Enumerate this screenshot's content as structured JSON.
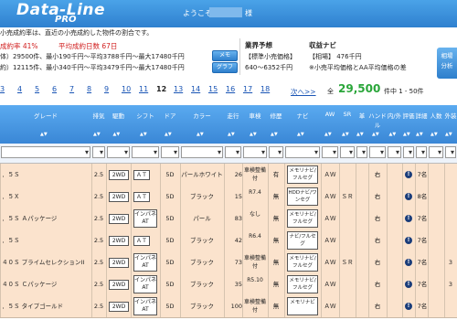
{
  "header": {
    "logo_main": "Data-Line",
    "logo_sub": "PRO",
    "welcome": "ようこそ",
    "honorific": "様"
  },
  "summary": {
    "note": "小売成約率は、直近の小売成約した物件の割合です。",
    "rate_label": "成約率 41%",
    "days_label": "平均成約日数 67日",
    "line1": "体）29500件、最小190千円〜平均3788千円〜最大17480千円",
    "line2": "約）12115件、最小340千円〜平均3479千円〜最大17480千円",
    "memo_button": "メモ",
    "graph_button": "グラフ"
  },
  "forecast": {
    "title": "業界予想",
    "standard_price": "【標準小売価格】",
    "range": "640〜6352千円"
  },
  "navi": {
    "title": "収益ナビ",
    "aa_label": "【相場】 476千円",
    "note": "※小売平均価格とAA平均価格の差"
  },
  "side_button": [
    "相場",
    "分析"
  ],
  "pager": {
    "pages": [
      "3",
      "4",
      "5",
      "6",
      "7",
      "8",
      "9",
      "10",
      "11",
      "12",
      "13",
      "14",
      "15",
      "16",
      "17",
      "18",
      "19",
      "20"
    ],
    "current": "12",
    "next_label": "次へ>>",
    "total_label": "全",
    "total_count": "29,500",
    "range_text": "件中 1 - 50件"
  },
  "table": {
    "headers": [
      "グレード",
      "排気",
      "駆動",
      "シフト",
      "ドア",
      "カラー",
      "走行",
      "車検",
      "修歴",
      "ナビ",
      "AW",
      "SR",
      "革",
      "ハンドル",
      "内/外",
      "評価",
      "詳細",
      "人数",
      "外装"
    ],
    "sort_glyph": "▲▼",
    "rows": [
      {
        "grade": "．５Ｓ",
        "displacement": "2.5",
        "drive": "2WD",
        "shift": "ＡＴ",
        "door": "5D",
        "color": "パールホワイト",
        "mileage": "26",
        "inspection": "車検整備付",
        "history": "有",
        "navi": "メモリナビ/フルセグ",
        "aw": "ＡＷ",
        "sr": "",
        "leather": "",
        "handle": "右",
        "rating": "",
        "seats": "7名",
        "exterior": ""
      },
      {
        "grade": "．５Ｘ",
        "displacement": "2.5",
        "drive": "2WD",
        "shift": "ＡＴ",
        "door": "5D",
        "color": "ブラック",
        "mileage": "15",
        "inspection": "R7.4",
        "history": "無",
        "navi": "HDDナビ/ワンセグ",
        "aw": "ＡＷ",
        "sr": "ＳＲ",
        "leather": "",
        "handle": "右",
        "rating": "",
        "seats": "8名",
        "exterior": ""
      },
      {
        "grade": "．５Ｓ Ａパッケージ",
        "displacement": "2.5",
        "drive": "2WD",
        "shift": "インパネAT",
        "door": "5D",
        "color": "パール",
        "mileage": "83",
        "inspection": "なし",
        "history": "無",
        "navi": "メモリナビ/フルセグ",
        "aw": "ＡＷ",
        "sr": "",
        "leather": "",
        "handle": "右",
        "rating": "",
        "seats": "7名",
        "exterior": ""
      },
      {
        "grade": "．５Ｓ",
        "displacement": "2.5",
        "drive": "2WD",
        "shift": "ＡＴ",
        "door": "5D",
        "color": "ブラック",
        "mileage": "42",
        "inspection": "R6.4",
        "history": "無",
        "navi": "ナビ/フルセグ",
        "aw": "ＡＷ",
        "sr": "",
        "leather": "",
        "handle": "右",
        "rating": "",
        "seats": "7名",
        "exterior": ""
      },
      {
        "grade": "４０Ｓ プライムセレクションII",
        "displacement": "2.5",
        "drive": "2WD",
        "shift": "インパネAT",
        "door": "5D",
        "color": "ブラック",
        "mileage": "73",
        "inspection": "車検整備付",
        "history": "無",
        "navi": "メモリナビ/フルセグ",
        "aw": "ＡＷ",
        "sr": "ＳＲ",
        "leather": "",
        "handle": "右",
        "rating": "",
        "seats": "7名",
        "exterior": "3"
      },
      {
        "grade": "４０Ｓ Ｃパッケージ",
        "displacement": "2.5",
        "drive": "2WD",
        "shift": "インパネAT",
        "door": "5D",
        "color": "ブラック",
        "mileage": "35",
        "inspection": "R5.10",
        "history": "無",
        "navi": "メモリナビ/フルセグ",
        "aw": "ＡＷ",
        "sr": "",
        "leather": "",
        "handle": "右",
        "rating": "",
        "seats": "7名",
        "exterior": "3"
      },
      {
        "grade": "．５Ｓ タイプゴールド",
        "displacement": "2.5",
        "drive": "2WD",
        "shift": "インパネAT",
        "door": "5D",
        "color": "ブラック",
        "mileage": "100",
        "inspection": "車検整備付",
        "history": "無",
        "navi": "メモリナビ",
        "aw": "ＡＷ",
        "sr": "",
        "leather": "",
        "handle": "右",
        "rating": "",
        "seats": "7名",
        "exterior": ""
      }
    ]
  }
}
